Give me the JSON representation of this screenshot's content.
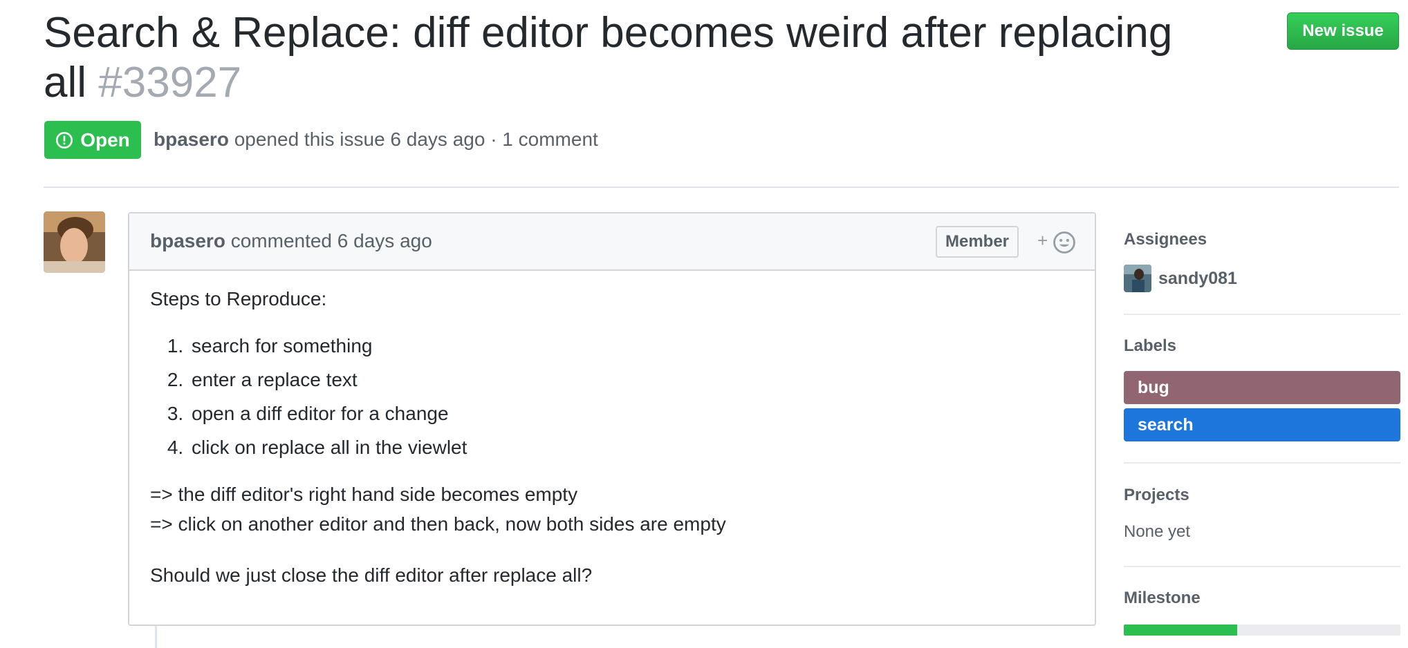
{
  "issue": {
    "title": "Search & Replace: diff editor becomes weird after replacing all",
    "number": "#33927",
    "state": "Open",
    "author": "bpasero",
    "opened_text": "opened this issue 6 days ago · 1 comment",
    "new_issue_label": "New issue"
  },
  "comment": {
    "author": "bpasero",
    "action": "commented 6 days ago",
    "badge": "Member",
    "reaction_glyph": "+",
    "body": {
      "intro": "Steps to Reproduce:",
      "steps": [
        "search for something",
        "enter a replace text",
        "open a diff editor for a change",
        "click on replace all in the viewlet"
      ],
      "results": [
        "=> the diff editor's right hand side becomes empty",
        "=> click on another editor and then back, now both sides are empty"
      ],
      "question": "Should we just close the diff editor after replace all?"
    }
  },
  "sidebar": {
    "assignees_title": "Assignees",
    "assignee": "sandy081",
    "labels_title": "Labels",
    "labels": [
      {
        "name": "bug",
        "color": "#916672"
      },
      {
        "name": "search",
        "color": "#1d76db"
      }
    ],
    "projects_title": "Projects",
    "projects_value": "None yet",
    "milestone_title": "Milestone",
    "milestone_progress": 0.41
  },
  "colors": {
    "open_green": "#2cbe4e",
    "button_green": "#28a745"
  }
}
